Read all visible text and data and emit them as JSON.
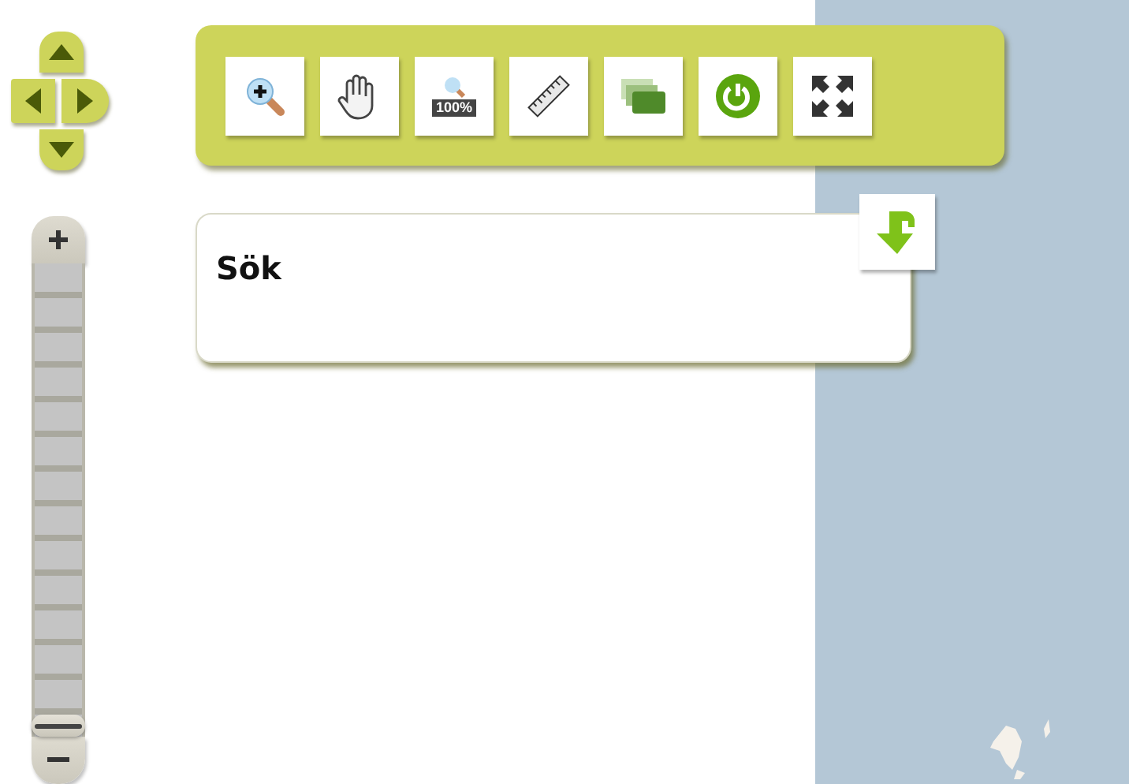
{
  "zoom_slider": {
    "level": 0.0
  },
  "toolbar": {
    "tools": [
      {
        "kind": "zoom-in"
      },
      {
        "kind": "pan"
      },
      {
        "kind": "zoom-full",
        "label": "100%"
      },
      {
        "kind": "measure"
      },
      {
        "kind": "layers"
      },
      {
        "kind": "power"
      },
      {
        "kind": "fullscreen"
      }
    ]
  },
  "search_panel": {
    "title": "Sök"
  }
}
